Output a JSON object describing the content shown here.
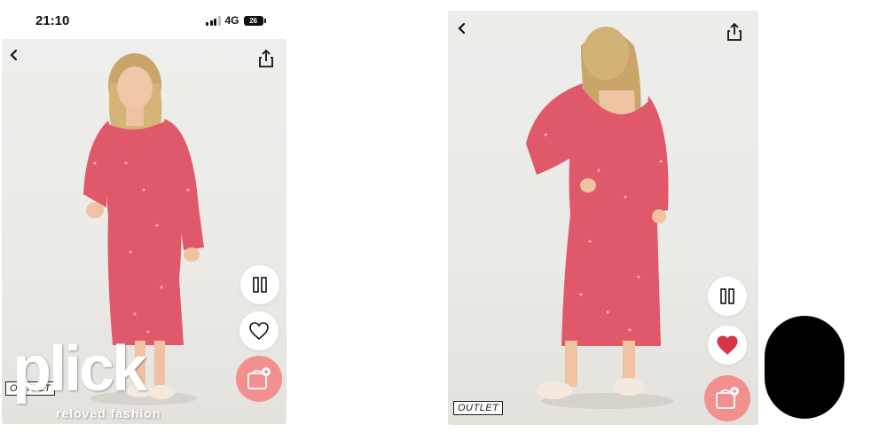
{
  "status_bar": {
    "time": "21:10",
    "network": "4G",
    "battery_level": "26"
  },
  "left_screen": {
    "outlet_label": "OUTLET",
    "liked": false
  },
  "right_screen": {
    "outlet_label": "OUTLET",
    "liked": true
  },
  "watermark": {
    "brand": "plick",
    "tagline": "reloved fashion"
  },
  "icons": {
    "back": "chevron-left-icon",
    "share": "share-icon",
    "pause": "pause-icon",
    "like": "heart-icon",
    "add_to_bag": "bag-plus-icon"
  },
  "colors": {
    "bag_button": "#f28f8f",
    "heart_liked": "#d9354a",
    "dress": "#e0596a"
  }
}
